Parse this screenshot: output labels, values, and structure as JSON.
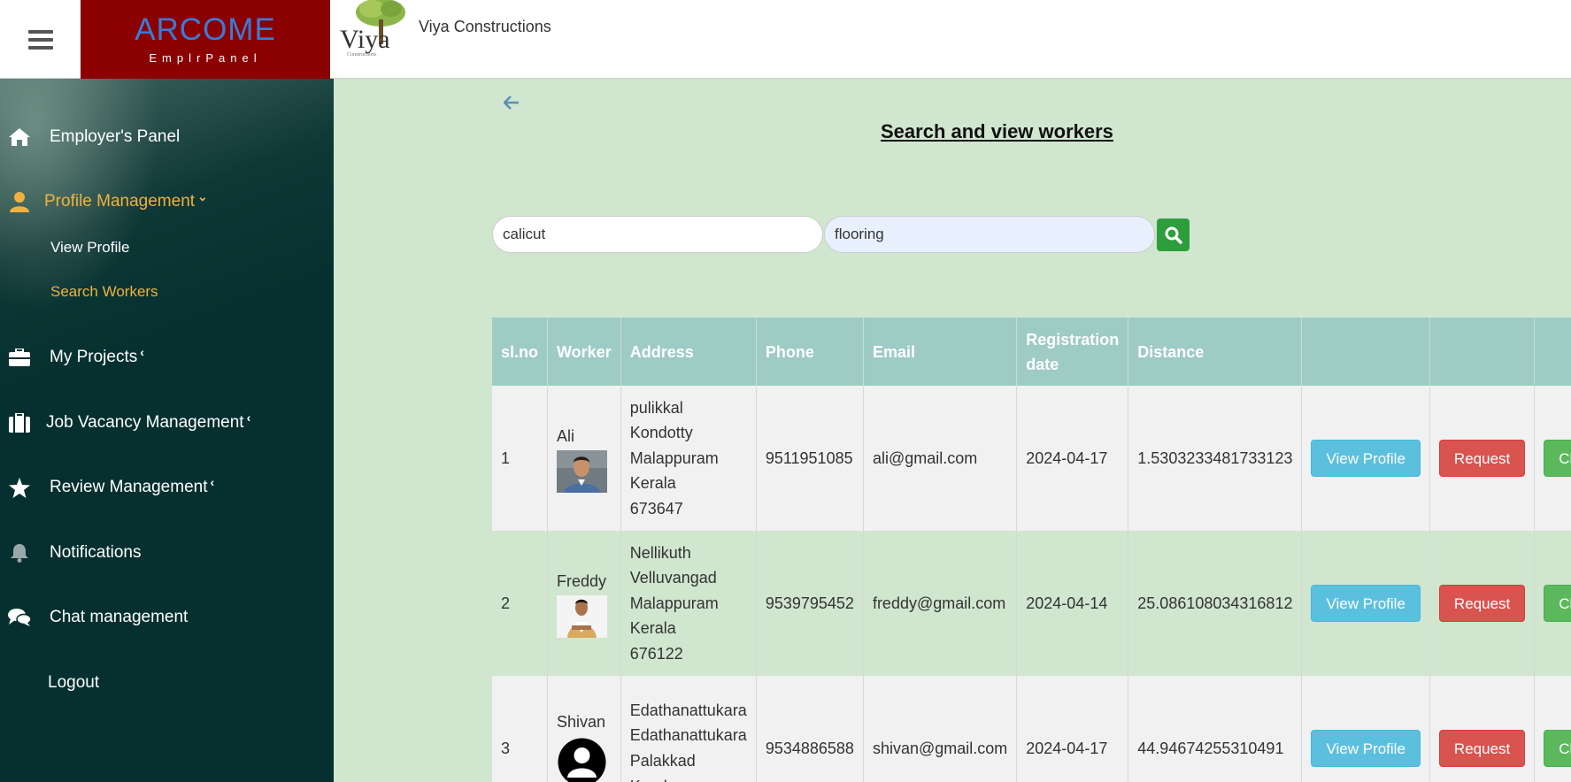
{
  "header": {
    "brand_title": "ARCOME",
    "brand_subtitle": "EmplrPanel",
    "logo_text": "Viya",
    "company_name": "Viya Constructions"
  },
  "sidebar": {
    "items": [
      {
        "label": "Employer's Panel",
        "icon": "home-icon"
      },
      {
        "label": "Profile Management",
        "icon": "user-icon",
        "caret": "⌄"
      },
      {
        "label": "My Projects",
        "icon": "briefcase-icon",
        "caret": "‹"
      },
      {
        "label": "Job Vacancy Management",
        "icon": "suitcase-icon",
        "caret": "‹"
      },
      {
        "label": "Review Management",
        "icon": "star-icon",
        "caret": "‹"
      },
      {
        "label": "Notifications",
        "icon": "bell-icon"
      },
      {
        "label": "Chat management",
        "icon": "chat-icon"
      },
      {
        "label": "Logout",
        "icon": ""
      }
    ],
    "sub_items": [
      {
        "label": "View Profile"
      },
      {
        "label": "Search Workers"
      }
    ]
  },
  "main": {
    "title": "Search and view workers",
    "search": {
      "location": "calicut",
      "skill": "flooring"
    },
    "table": {
      "headers": [
        "sl.no",
        "Worker",
        "Address",
        "Phone",
        "Email",
        "Registration date",
        "Distance",
        "",
        "",
        ""
      ],
      "rows": [
        {
          "sl": "1",
          "name": "Ali",
          "address": [
            "pulikkal",
            "Kondotty",
            "Malappuram",
            "Kerala",
            "673647"
          ],
          "phone": "9511951085",
          "email": "ali@gmail.com",
          "date": "2024-04-17",
          "distance": "1.5303233481733123"
        },
        {
          "sl": "2",
          "name": "Freddy",
          "address": [
            "Nellikuth",
            "Velluvangad",
            "Malappuram",
            "Kerala",
            "676122"
          ],
          "phone": "9539795452",
          "email": "freddy@gmail.com",
          "date": "2024-04-14",
          "distance": "25.086108034316812"
        },
        {
          "sl": "3",
          "name": "Shivan",
          "address": [
            "Edathanattukara",
            "Edathanattukara",
            "Palakkad",
            "Kerala"
          ],
          "phone": "9534886588",
          "email": "shivan@gmail.com",
          "date": "2024-04-17",
          "distance": "44.94674255310491"
        }
      ],
      "buttons": {
        "view": "View Profile",
        "request": "Request",
        "chat": "Chat"
      }
    }
  },
  "colors": {
    "brand_bg": "#8b0000",
    "brand_title": "#3b7bd6",
    "sidebar_bg": "#012a2c",
    "active": "#f0b13e",
    "content_bg": "#d0e6cf",
    "table_header": "#9ecbc4"
  }
}
